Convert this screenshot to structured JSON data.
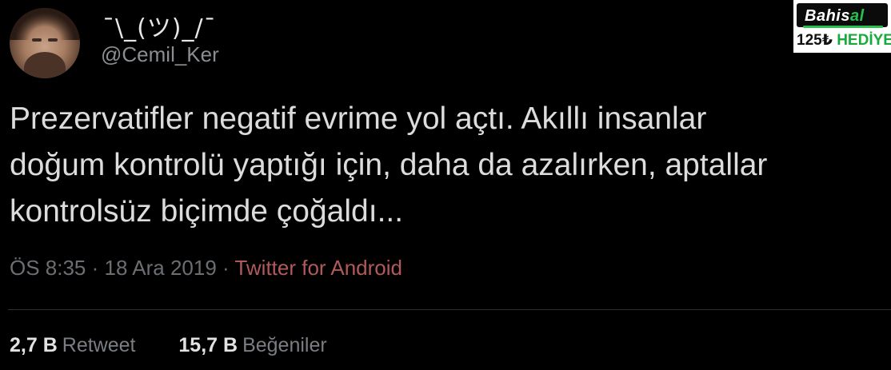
{
  "user": {
    "display_name": "¯\\_(ツ)_/¯",
    "handle": "@Cemil_Ker",
    "avatar": "avatar-photo"
  },
  "tweet": {
    "lines": [
      "Prezervatifler negatif evrime yol açtı. Akıllı insanlar",
      "doğum kontrolü yaptığı için, daha da azalırken, aptallar",
      "kontrolsüz biçimde çoğaldı..."
    ]
  },
  "meta": {
    "time": "ÖS 8:35",
    "date": "18 Ara 2019",
    "separator": "·",
    "source": "Twitter for Android"
  },
  "stats": {
    "retweets_count": "2,7 B",
    "retweets_label": "Retweet",
    "likes_count": "15,7 B",
    "likes_label": "Beğeniler"
  },
  "badge": {
    "brand_main": "Bahis",
    "brand_accent": "al",
    "promo_amount": "125₺",
    "promo_label": "HEDİYE"
  },
  "colors": {
    "background": "#000000",
    "source_link": "#b05a5a",
    "badge_green": "#27c04c"
  }
}
